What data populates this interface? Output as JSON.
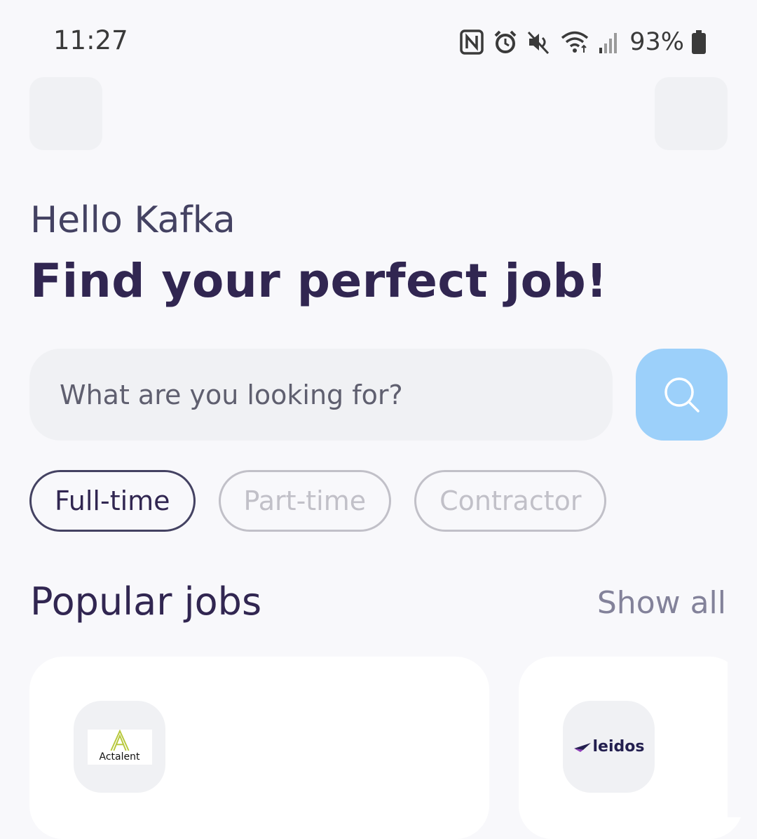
{
  "status_bar": {
    "time": "11:27",
    "battery_percent": "93%",
    "icons": [
      "nfc-icon",
      "alarm-icon",
      "mute-icon",
      "wifi-icon",
      "signal-icon",
      "battery-icon"
    ]
  },
  "header": {
    "left_button_icon": "menu-icon",
    "right_button_icon": "profile-icon"
  },
  "welcome": {
    "greeting": "Hello Kafka",
    "headline": "Find your perfect job!"
  },
  "search": {
    "placeholder": "What are you looking for?",
    "value": "",
    "button_icon": "search-icon"
  },
  "job_types": [
    {
      "label": "Full-time",
      "active": true
    },
    {
      "label": "Part-time",
      "active": false
    },
    {
      "label": "Contractor",
      "active": false
    }
  ],
  "popular": {
    "title": "Popular jobs",
    "show_all": "Show all",
    "jobs": [
      {
        "company_logo_text": "Actalent"
      },
      {
        "company_logo_text": "leidos"
      }
    ]
  },
  "colors": {
    "primary": "#312651",
    "secondary": "#444262",
    "gray": "#83829a",
    "search_button": "#9cd0fa",
    "background": "#f8f8fb",
    "card": "#ffffff",
    "input_bg": "#f0f1f4",
    "inactive_chip": "#c1c0c8"
  }
}
